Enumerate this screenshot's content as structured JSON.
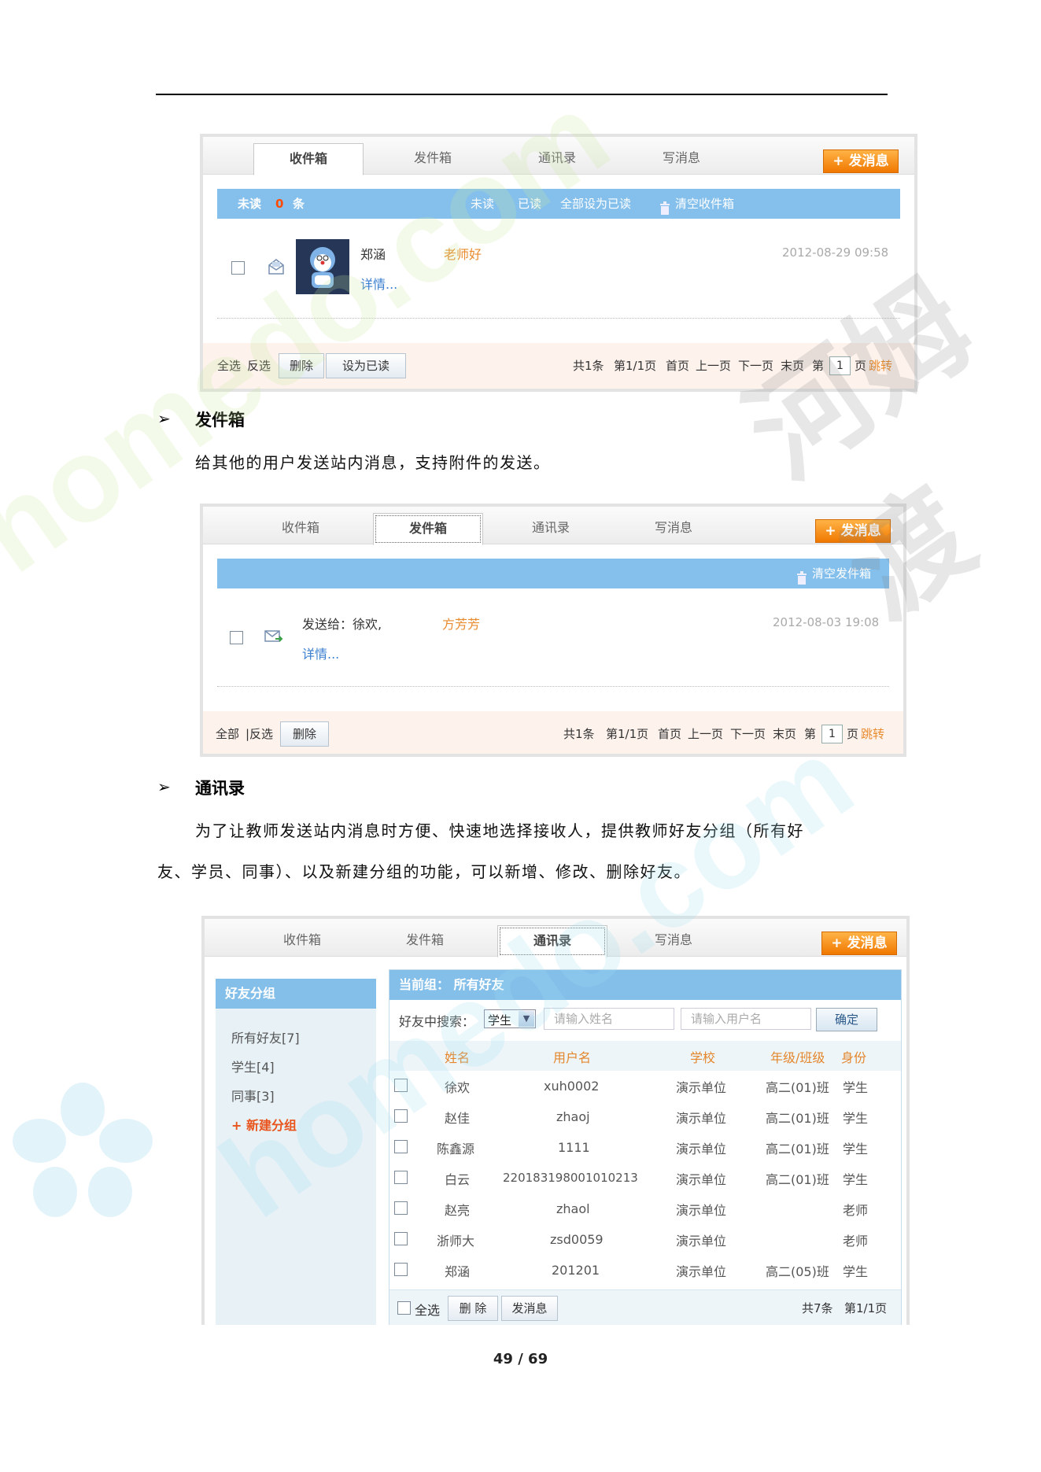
{
  "tabs": [
    "收件箱",
    "发件箱",
    "通讯录",
    "写消息"
  ],
  "send_button": "+ 发消息",
  "inbox": {
    "unread_label": "未读",
    "unread_count": "0",
    "unread_unit": "条",
    "bar_actions": [
      "未读",
      "已读",
      "全部设为已读",
      "清空收件箱"
    ],
    "message": {
      "sender": "郑涵",
      "detail": "详情...",
      "subject": "老师好",
      "date": "2012-08-29 09:58"
    },
    "footer": {
      "select_all": "全选",
      "invert": "反选",
      "delete": "删除",
      "mark_read": "设为已读",
      "total": "共1条",
      "page": "第1/1页",
      "first": "首页",
      "prev": "上一页",
      "next": "下一页",
      "last": "末页",
      "goto_prefix": "第",
      "page_input": "1",
      "goto_suffix": "页",
      "jump": "跳转"
    }
  },
  "section_outbox": {
    "title": "发件箱",
    "desc": "给其他的用户发送站内消息，支持附件的发送。"
  },
  "outbox": {
    "clear": "清空发件箱",
    "message": {
      "to": "发送给：徐欢,",
      "detail": "详情...",
      "subject": "方芳芳",
      "date": "2012-08-03 19:08"
    },
    "footer": {
      "select_all": "全部",
      "invert": "|反选",
      "delete": "删除",
      "total": "共1条",
      "page": "第1/1页",
      "first": "首页",
      "prev": "上一页",
      "next": "下一页",
      "last": "末页",
      "goto_prefix": "第",
      "page_input": "1",
      "goto_suffix": "页",
      "jump": "跳转"
    }
  },
  "section_contacts": {
    "title": "通讯录",
    "desc_line1": "为了让教师发送站内消息时方便、快速地选择接收人，提供教师好友分组（所有好",
    "desc_line2": "友、学员、同事）、以及新建分组的功能，可以新增、修改、删除好友。"
  },
  "contacts": {
    "sidebar_title": "好友分组",
    "groups": [
      "所有好友[7]",
      "学生[4]",
      "同事[3]"
    ],
    "new_group": "+ 新建分组",
    "current_group": "当前组： 所有好友",
    "search_label": "好友中搜索：",
    "search_select": "学生",
    "name_placeholder": "请输入姓名",
    "user_placeholder": "请输入用户名",
    "confirm": "确定",
    "columns": [
      "姓名",
      "用户名",
      "学校",
      "年级/班级",
      "身份"
    ],
    "rows": [
      [
        "徐欢",
        "xuh0002",
        "演示单位",
        "高二(01)班",
        "学生"
      ],
      [
        "赵佳",
        "zhaoj",
        "演示单位",
        "高二(01)班",
        "学生"
      ],
      [
        "陈鑫源",
        "1111",
        "演示单位",
        "高二(01)班",
        "学生"
      ],
      [
        "白云",
        "220183198001010213",
        "演示单位",
        "高二(01)班",
        "学生"
      ],
      [
        "赵亮",
        "zhaol",
        "演示单位",
        "",
        "老师"
      ],
      [
        "浙师大",
        "zsd0059",
        "演示单位",
        "",
        "老师"
      ],
      [
        "郑涵",
        "201201",
        "演示单位",
        "高二(05)班",
        "学生"
      ]
    ],
    "footer": {
      "select_all": "全选",
      "delete": "删 除",
      "send": "发消息",
      "total": "共7条",
      "page": "第1/1页"
    }
  },
  "watermark": {
    "text1": "homedo.com",
    "text2": "homedo.com",
    "text3": "河姆渡"
  },
  "page_number": "49 / 69"
}
